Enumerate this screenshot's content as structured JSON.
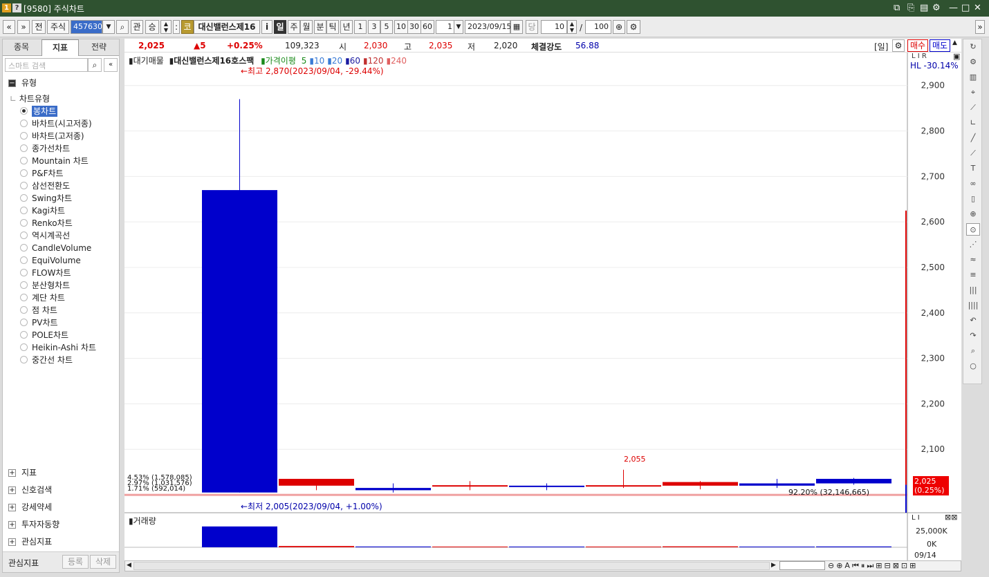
{
  "window": {
    "badge1": "1",
    "badge2": "?",
    "title": "[9580] 주식차트"
  },
  "toolbar": {
    "prev": "«",
    "next": "»",
    "all": "전",
    "market": "주식",
    "code": "457630",
    "search": "⌕",
    "gwan": "관",
    "seung": "승",
    "kor_tag": "코",
    "stock_name": "대신밸런스제16",
    "info": "i",
    "periods": [
      "일",
      "주",
      "월",
      "분",
      "틱",
      "년"
    ],
    "active_period": "일",
    "minutes": [
      "1",
      "3",
      "5",
      "10",
      "30",
      "60"
    ],
    "unit_value": "1",
    "date": "2023/09/15",
    "dang": "당",
    "count": "10",
    "slash": "/",
    "total": "100",
    "expand": "»"
  },
  "left_panel": {
    "tabs": [
      "종목",
      "지표",
      "전략"
    ],
    "active_tab": "지표",
    "search_placeholder": "스마트 검색",
    "section_type": "유형",
    "tree_group": "차트유형",
    "chart_types": [
      "봉차트",
      "바차트(시고저종)",
      "바차트(고저종)",
      "종가선차트",
      "Mountain 차트",
      "P&F차트",
      "삼선전환도",
      "Swing차트",
      "Kagi차트",
      "Renko차트",
      "역시계곡선",
      "CandleVolume",
      "EquiVolume",
      "FLOW차트",
      "분산형차트",
      "계단 차트",
      "점 차트",
      "PV차트",
      "POLE차트",
      "Heikin-Ashi 차트",
      "중간선 차트"
    ],
    "selected_type": "봉차트",
    "bottom_sections": [
      "지표",
      "신호검색",
      "강세약세",
      "투자자동향",
      "관심지표"
    ],
    "footer_label": "관심지표",
    "footer_buttons": [
      "등록",
      "삭제"
    ]
  },
  "quote": {
    "price": "2,025",
    "change": "▲5",
    "change_pct": "+0.25%",
    "volume": "109,323",
    "open_label": "시",
    "open": "2,030",
    "high_label": "고",
    "high": "2,035",
    "low_label": "저",
    "low": "2,020",
    "strength_label": "체결강도",
    "strength": "56.88",
    "period_tag": "[일]",
    "buy": "매수",
    "sell": "매도"
  },
  "chart": {
    "legend_prefix": "대기매물",
    "legend_name": "대신밸런스제16호스팩",
    "legend_ma": "가격이평",
    "legend_periods": [
      "5",
      "10",
      "20",
      "60",
      "120",
      "240"
    ],
    "legend_colors": [
      "#1a8a1a",
      "#3a7bd5",
      "#3a7bd5",
      "#1a1aa0",
      "#c03030",
      "#e06060"
    ],
    "hl_label": "HL -30.14%",
    "max_annotation": "←최고 2,870(2023/09/04, -29.44%)",
    "min_annotation": "←최저 2,005(2023/09/04, +1.00%)",
    "peak_label": "2,055",
    "current_price_label": "2,025",
    "current_pct_label": "(0.25%)",
    "profile_labels": [
      "4.53% (1,578,085)",
      "2.97% (1,031,576)",
      "1.71% (592,014)"
    ],
    "profile_right_label": "92.20% (32,146,665)",
    "volume_title": "거래량",
    "volume_ticks": [
      "25,000K",
      "0K"
    ],
    "x_label": "09/14",
    "up_color": "#dd0000",
    "down_color": "#0000cc"
  },
  "chart_data": {
    "type": "candlestick",
    "y_ticks": [
      2100,
      2200,
      2300,
      2400,
      2500,
      2600,
      2700,
      2800,
      2900
    ],
    "ylim": [
      2000,
      2930
    ],
    "candles": [
      {
        "open": 2670,
        "high": 2870,
        "low": 2005,
        "close": 2005,
        "volume": 33500
      },
      {
        "open": 2020,
        "high": 2035,
        "low": 2010,
        "close": 2035,
        "volume": 2000
      },
      {
        "open": 2015,
        "high": 2025,
        "low": 2005,
        "close": 2010,
        "volume": 1200
      },
      {
        "open": 2020,
        "high": 2030,
        "low": 2010,
        "close": 2021,
        "volume": 900
      },
      {
        "open": 2020,
        "high": 2025,
        "low": 2010,
        "close": 2019,
        "volume": 800
      },
      {
        "open": 2020,
        "high": 2055,
        "low": 2015,
        "close": 2021,
        "volume": 1100
      },
      {
        "open": 2020,
        "high": 2030,
        "low": 2012,
        "close": 2028,
        "volume": 1500
      },
      {
        "open": 2025,
        "high": 2035,
        "low": 2015,
        "close": 2020,
        "volume": 1000
      },
      {
        "open": 2035,
        "high": 2037,
        "low": 2022,
        "close": 2025,
        "volume": 1300
      }
    ]
  }
}
